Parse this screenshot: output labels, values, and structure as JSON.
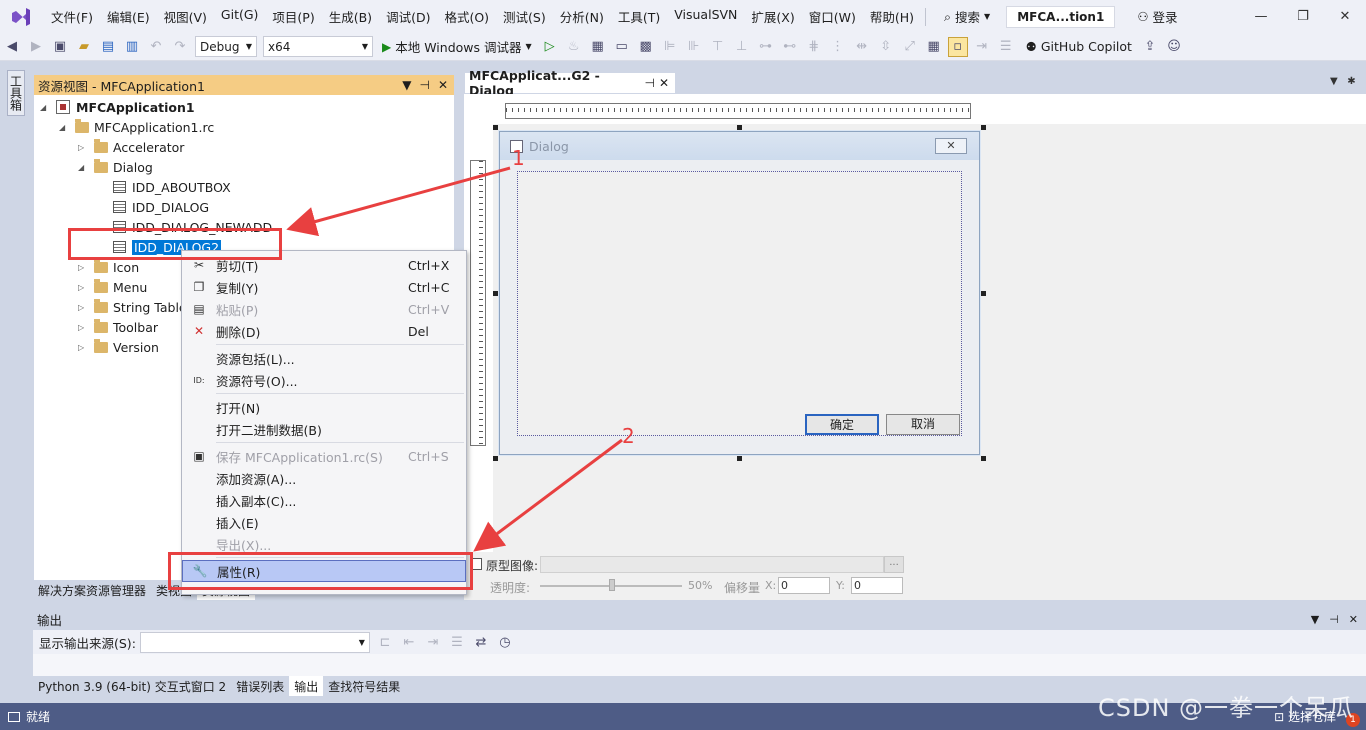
{
  "menubar": {
    "items": [
      "文件(F)",
      "编辑(E)",
      "视图(V)",
      "Git(G)",
      "项目(P)",
      "生成(B)",
      "调试(D)",
      "格式(O)",
      "测试(S)",
      "分析(N)",
      "工具(T)",
      "VisualSVN",
      "扩展(X)",
      "窗口(W)",
      "帮助(H)"
    ],
    "search_label": "搜索",
    "project_name": "MFCA...tion1",
    "login_label": "登录"
  },
  "toolbar": {
    "config": "Debug",
    "platform": "x64",
    "run_label": "本地 Windows 调试器",
    "copilot_label": "GitHub Copilot"
  },
  "toolbox_tab": "工具箱",
  "resview": {
    "title": "资源视图 - MFCApplication1",
    "tree": [
      {
        "label": "MFCApplication1",
        "level": 0,
        "kind": "project",
        "expanded": true,
        "bold": true
      },
      {
        "label": "MFCApplication1.rc",
        "level": 1,
        "kind": "folder",
        "expanded": true
      },
      {
        "label": "Accelerator",
        "level": 2,
        "kind": "folder",
        "expanded": false
      },
      {
        "label": "Dialog",
        "level": 2,
        "kind": "folder",
        "expanded": true
      },
      {
        "label": "IDD_ABOUTBOX",
        "level": 3,
        "kind": "file"
      },
      {
        "label": "IDD_DIALOG",
        "level": 3,
        "kind": "file"
      },
      {
        "label": "IDD_DIALOG_NEWADD",
        "level": 3,
        "kind": "file"
      },
      {
        "label": "IDD_DIALOG2",
        "level": 3,
        "kind": "file",
        "selected": true
      },
      {
        "label": "Icon",
        "level": 2,
        "kind": "folder",
        "expanded": false
      },
      {
        "label": "Menu",
        "level": 2,
        "kind": "folder",
        "expanded": false
      },
      {
        "label": "String Table",
        "level": 2,
        "kind": "folder",
        "expanded": false
      },
      {
        "label": "Toolbar",
        "level": 2,
        "kind": "folder",
        "expanded": false
      },
      {
        "label": "Version",
        "level": 2,
        "kind": "folder",
        "expanded": false
      }
    ],
    "tabs": [
      "解决方案资源管理器",
      "类视图",
      "资源视图"
    ]
  },
  "editor": {
    "tab_title": "MFCApplicat...G2 - Dialog",
    "dialog_caption": "Dialog",
    "ok_label": "确定",
    "cancel_label": "取消",
    "prototype_label": "原型图像:",
    "opacity_label": "透明度:",
    "opacity_value": "50%",
    "offset_label": "偏移量",
    "x_label": "X:",
    "x_value": "0",
    "y_label": "Y:",
    "y_value": "0",
    "browse_label": "..."
  },
  "context_menu": {
    "items": [
      {
        "label": "剪切(T)",
        "shortcut": "Ctrl+X",
        "icon": "scissors-icon",
        "disabled": false
      },
      {
        "label": "复制(Y)",
        "shortcut": "Ctrl+C",
        "icon": "copy-icon",
        "disabled": false
      },
      {
        "label": "粘贴(P)",
        "shortcut": "Ctrl+V",
        "icon": "paste-icon",
        "disabled": true
      },
      {
        "label": "删除(D)",
        "shortcut": "Del",
        "icon": "delete-icon",
        "disabled": false
      },
      {
        "label": "资源包括(L)...",
        "shortcut": "",
        "icon": "",
        "disabled": false,
        "sep_before": true
      },
      {
        "label": "资源符号(O)...",
        "shortcut": "",
        "icon": "id-icon",
        "disabled": false
      },
      {
        "label": "打开(N)",
        "shortcut": "",
        "icon": "",
        "disabled": false,
        "sep_before": true
      },
      {
        "label": "打开二进制数据(B)",
        "shortcut": "",
        "icon": "",
        "disabled": false
      },
      {
        "label": "保存 MFCApplication1.rc(S)",
        "shortcut": "Ctrl+S",
        "icon": "save-icon",
        "disabled": true,
        "sep_before": true
      },
      {
        "label": "添加资源(A)...",
        "shortcut": "",
        "icon": "",
        "disabled": false
      },
      {
        "label": "插入副本(C)...",
        "shortcut": "",
        "icon": "",
        "disabled": false
      },
      {
        "label": "插入(E)",
        "shortcut": "",
        "icon": "",
        "disabled": false
      },
      {
        "label": "导出(X)...",
        "shortcut": "",
        "icon": "",
        "disabled": true
      },
      {
        "label": "属性(R)",
        "shortcut": "",
        "icon": "wrench-icon",
        "disabled": false,
        "sep_before": true,
        "highlighted": true
      }
    ]
  },
  "output": {
    "title": "输出",
    "source_label": "显示输出来源(S):",
    "tabs": [
      "Python 3.9 (64-bit) 交互式窗口 2",
      "错误列表",
      "输出",
      "查找符号结果"
    ]
  },
  "status": {
    "ready": "就绪",
    "repo": "选择仓库",
    "badge": "1"
  },
  "annotations": {
    "label1": "1",
    "label2": "2",
    "color": "#e84040"
  },
  "watermark": "CSDN @一拳一个呆瓜",
  "colors": {
    "accent": "#0078d7",
    "panel_title": "#f5cc84",
    "status_bar": "#4e5c86",
    "menu_highlight": "#b8c8f5"
  }
}
